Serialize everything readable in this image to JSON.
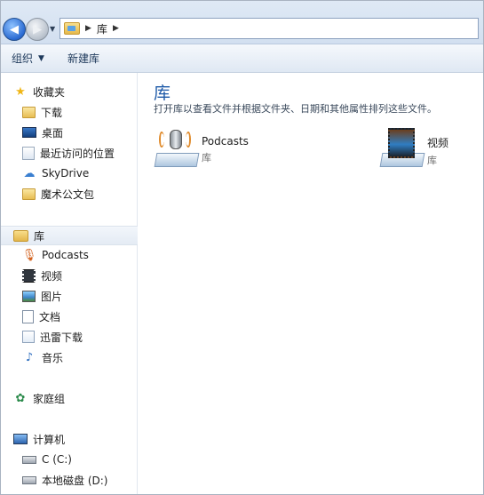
{
  "address": {
    "crumbs": [
      "库"
    ]
  },
  "toolbar": {
    "organize": "组织",
    "new_library": "新建库"
  },
  "nav": {
    "favorites": "收藏夹",
    "favorites_items": [
      "下载",
      "桌面",
      "最近访问的位置",
      "SkyDrive",
      "魔术公文包"
    ],
    "libraries": "库",
    "library_items": [
      "Podcasts",
      "视频",
      "图片",
      "文档",
      "迅雷下载",
      "音乐"
    ],
    "homegroup": "家庭组",
    "computer": "计算机",
    "computer_items": [
      "C (C:)",
      "本地磁盘 (D:)"
    ]
  },
  "content": {
    "title": "库",
    "description": "打开库以查看文件并根据文件夹、日期和其他属性排列这些文件。",
    "items": [
      {
        "name": "Podcasts",
        "type": "库",
        "icon": "podcast-library-icon"
      },
      {
        "name": "视频",
        "type": "库",
        "icon": "video-library-icon"
      }
    ]
  },
  "colors": {
    "accent_title": "#1e5aa8",
    "toolbar_text": "#1e395b"
  }
}
